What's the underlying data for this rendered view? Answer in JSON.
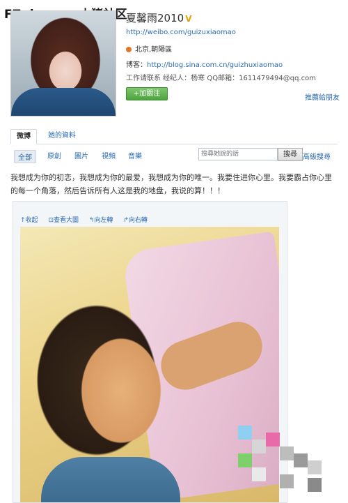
{
  "watermark": {
    "latin": "FZpig.com",
    "cn": "小猪社区"
  },
  "profile": {
    "name": "夏馨雨2010",
    "verified_mark": "V",
    "weibo_url": "http://weibo.com/guizuxiaomao",
    "location": "北京,朝陽區",
    "blog_label": "博客：",
    "blog_url": "http://blog.sina.com.cn/guizhuxiaomao",
    "work_contact": "工作请联系 经纪人：杨寒 QQ邮箱：1611479494@qq.com",
    "follow_button": "+加關注",
    "recommend_link": "推薦給朋友"
  },
  "tabs": [
    {
      "label": "微博"
    },
    {
      "label": "她的資料"
    }
  ],
  "filters": [
    {
      "label": "全部"
    },
    {
      "label": "原創"
    },
    {
      "label": "圖片"
    },
    {
      "label": "視頻"
    },
    {
      "label": "音樂"
    }
  ],
  "search": {
    "placeholder": "搜尋她說的話",
    "button": "搜尋",
    "advanced": "高級搜尋"
  },
  "post": {
    "text": "我想成为你的初恋，我想成为你的最爱，我想成为你的唯一。我要住进你心里。我要霸占你心里的每一个角落，然后告诉所有人这是我的地盘，我说的算！！！"
  },
  "media_toolbar": {
    "collapse": "收起",
    "view_large": "查看大圖",
    "rotate_left": "向左轉",
    "rotate_right": "向右轉"
  },
  "colors": {
    "link": "#2a6ab1",
    "follow_green": "#4da43d",
    "verified_gold": "#e8a100"
  }
}
